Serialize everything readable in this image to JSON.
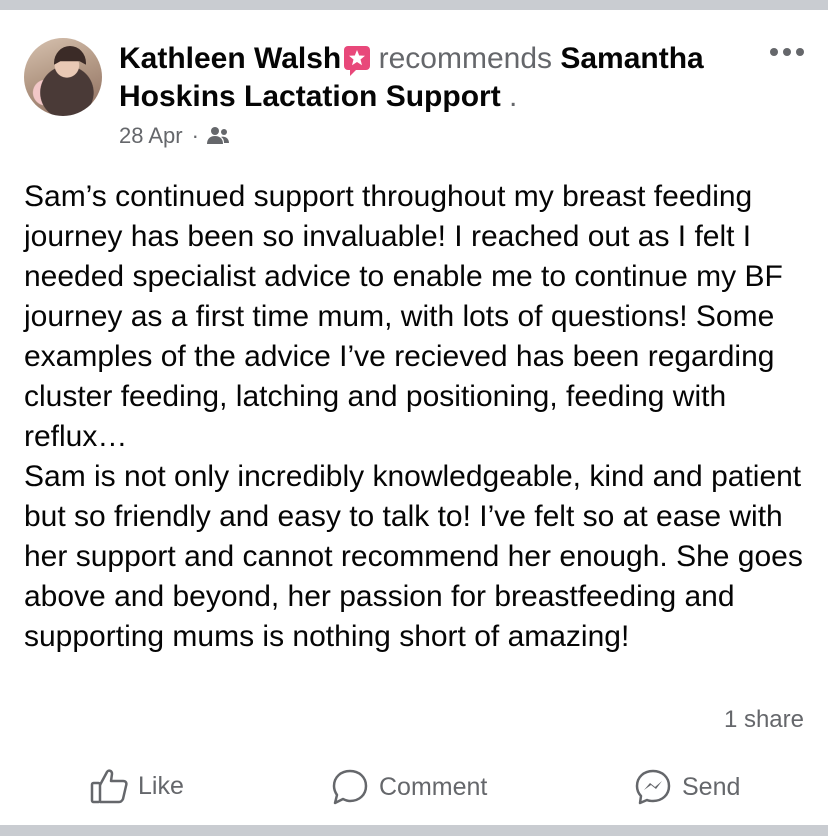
{
  "post": {
    "author": "Kathleen Walsh",
    "badge_icon": "recommendation-flag-icon",
    "verb": "recommends",
    "page_name": "Samantha Hoskins Lactation Support",
    "trailing_period": ".",
    "date": "28 Apr",
    "separator": "·",
    "audience_icon": "friends-audience-icon",
    "body_paragraphs": [
      "Sam’s continued support throughout my breast feeding journey has been so invaluable! I reached out as I felt I needed specialist advice to enable me to continue my BF journey as a first time mum, with lots of questions! Some examples of the advice I’ve recieved has been regarding cluster feeding, latching and positioning, feeding with reflux…",
      "Sam is not only incredibly knowledgeable, kind and patient but so friendly and easy to talk to! I’ve felt so at ease with her support and cannot recommend her enough. She goes above and beyond, her passion for breastfeeding and supporting mums is nothing short of amazing!"
    ],
    "share_count": "1 share"
  },
  "actions": {
    "like_label": "Like",
    "comment_label": "Comment",
    "send_label": "Send"
  },
  "colors": {
    "page_bg": "#c9ccd1",
    "card_bg": "#ffffff",
    "text": "#050505",
    "secondary": "#65676b",
    "badge": "#e8487a"
  }
}
